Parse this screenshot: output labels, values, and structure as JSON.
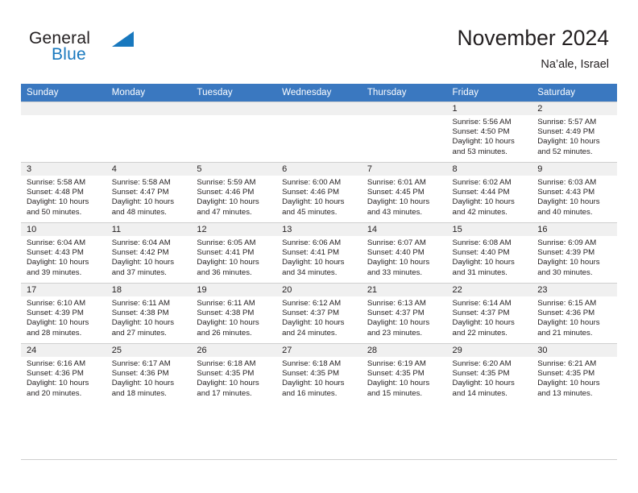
{
  "brand": {
    "word_one": "General",
    "word_two": "Blue",
    "triangle_icon": "triangle-logo-icon"
  },
  "header": {
    "title": "November 2024",
    "subtitle": "Na’ale, Israel"
  },
  "colors": {
    "header_blue": "#3a78c0",
    "brand_blue": "#1878be",
    "daynum_strip": "#f0f0f0",
    "grid_line": "#cfcfcf",
    "text": "#231f20"
  },
  "calendar": {
    "weekday_headers": [
      "Sunday",
      "Monday",
      "Tuesday",
      "Wednesday",
      "Thursday",
      "Friday",
      "Saturday"
    ],
    "weeks": [
      [
        {
          "day": "",
          "empty": true,
          "lines": []
        },
        {
          "day": "",
          "empty": true,
          "lines": []
        },
        {
          "day": "",
          "empty": true,
          "lines": []
        },
        {
          "day": "",
          "empty": true,
          "lines": []
        },
        {
          "day": "",
          "empty": true,
          "lines": []
        },
        {
          "day": "1",
          "empty": false,
          "lines": [
            "Sunrise: 5:56 AM",
            "Sunset: 4:50 PM",
            "Daylight: 10 hours",
            "and 53 minutes."
          ]
        },
        {
          "day": "2",
          "empty": false,
          "lines": [
            "Sunrise: 5:57 AM",
            "Sunset: 4:49 PM",
            "Daylight: 10 hours",
            "and 52 minutes."
          ]
        }
      ],
      [
        {
          "day": "3",
          "empty": false,
          "lines": [
            "Sunrise: 5:58 AM",
            "Sunset: 4:48 PM",
            "Daylight: 10 hours",
            "and 50 minutes."
          ]
        },
        {
          "day": "4",
          "empty": false,
          "lines": [
            "Sunrise: 5:58 AM",
            "Sunset: 4:47 PM",
            "Daylight: 10 hours",
            "and 48 minutes."
          ]
        },
        {
          "day": "5",
          "empty": false,
          "lines": [
            "Sunrise: 5:59 AM",
            "Sunset: 4:46 PM",
            "Daylight: 10 hours",
            "and 47 minutes."
          ]
        },
        {
          "day": "6",
          "empty": false,
          "lines": [
            "Sunrise: 6:00 AM",
            "Sunset: 4:46 PM",
            "Daylight: 10 hours",
            "and 45 minutes."
          ]
        },
        {
          "day": "7",
          "empty": false,
          "lines": [
            "Sunrise: 6:01 AM",
            "Sunset: 4:45 PM",
            "Daylight: 10 hours",
            "and 43 minutes."
          ]
        },
        {
          "day": "8",
          "empty": false,
          "lines": [
            "Sunrise: 6:02 AM",
            "Sunset: 4:44 PM",
            "Daylight: 10 hours",
            "and 42 minutes."
          ]
        },
        {
          "day": "9",
          "empty": false,
          "lines": [
            "Sunrise: 6:03 AM",
            "Sunset: 4:43 PM",
            "Daylight: 10 hours",
            "and 40 minutes."
          ]
        }
      ],
      [
        {
          "day": "10",
          "empty": false,
          "lines": [
            "Sunrise: 6:04 AM",
            "Sunset: 4:43 PM",
            "Daylight: 10 hours",
            "and 39 minutes."
          ]
        },
        {
          "day": "11",
          "empty": false,
          "lines": [
            "Sunrise: 6:04 AM",
            "Sunset: 4:42 PM",
            "Daylight: 10 hours",
            "and 37 minutes."
          ]
        },
        {
          "day": "12",
          "empty": false,
          "lines": [
            "Sunrise: 6:05 AM",
            "Sunset: 4:41 PM",
            "Daylight: 10 hours",
            "and 36 minutes."
          ]
        },
        {
          "day": "13",
          "empty": false,
          "lines": [
            "Sunrise: 6:06 AM",
            "Sunset: 4:41 PM",
            "Daylight: 10 hours",
            "and 34 minutes."
          ]
        },
        {
          "day": "14",
          "empty": false,
          "lines": [
            "Sunrise: 6:07 AM",
            "Sunset: 4:40 PM",
            "Daylight: 10 hours",
            "and 33 minutes."
          ]
        },
        {
          "day": "15",
          "empty": false,
          "lines": [
            "Sunrise: 6:08 AM",
            "Sunset: 4:40 PM",
            "Daylight: 10 hours",
            "and 31 minutes."
          ]
        },
        {
          "day": "16",
          "empty": false,
          "lines": [
            "Sunrise: 6:09 AM",
            "Sunset: 4:39 PM",
            "Daylight: 10 hours",
            "and 30 minutes."
          ]
        }
      ],
      [
        {
          "day": "17",
          "empty": false,
          "lines": [
            "Sunrise: 6:10 AM",
            "Sunset: 4:39 PM",
            "Daylight: 10 hours",
            "and 28 minutes."
          ]
        },
        {
          "day": "18",
          "empty": false,
          "lines": [
            "Sunrise: 6:11 AM",
            "Sunset: 4:38 PM",
            "Daylight: 10 hours",
            "and 27 minutes."
          ]
        },
        {
          "day": "19",
          "empty": false,
          "lines": [
            "Sunrise: 6:11 AM",
            "Sunset: 4:38 PM",
            "Daylight: 10 hours",
            "and 26 minutes."
          ]
        },
        {
          "day": "20",
          "empty": false,
          "lines": [
            "Sunrise: 6:12 AM",
            "Sunset: 4:37 PM",
            "Daylight: 10 hours",
            "and 24 minutes."
          ]
        },
        {
          "day": "21",
          "empty": false,
          "lines": [
            "Sunrise: 6:13 AM",
            "Sunset: 4:37 PM",
            "Daylight: 10 hours",
            "and 23 minutes."
          ]
        },
        {
          "day": "22",
          "empty": false,
          "lines": [
            "Sunrise: 6:14 AM",
            "Sunset: 4:37 PM",
            "Daylight: 10 hours",
            "and 22 minutes."
          ]
        },
        {
          "day": "23",
          "empty": false,
          "lines": [
            "Sunrise: 6:15 AM",
            "Sunset: 4:36 PM",
            "Daylight: 10 hours",
            "and 21 minutes."
          ]
        }
      ],
      [
        {
          "day": "24",
          "empty": false,
          "lines": [
            "Sunrise: 6:16 AM",
            "Sunset: 4:36 PM",
            "Daylight: 10 hours",
            "and 20 minutes."
          ]
        },
        {
          "day": "25",
          "empty": false,
          "lines": [
            "Sunrise: 6:17 AM",
            "Sunset: 4:36 PM",
            "Daylight: 10 hours",
            "and 18 minutes."
          ]
        },
        {
          "day": "26",
          "empty": false,
          "lines": [
            "Sunrise: 6:18 AM",
            "Sunset: 4:35 PM",
            "Daylight: 10 hours",
            "and 17 minutes."
          ]
        },
        {
          "day": "27",
          "empty": false,
          "lines": [
            "Sunrise: 6:18 AM",
            "Sunset: 4:35 PM",
            "Daylight: 10 hours",
            "and 16 minutes."
          ]
        },
        {
          "day": "28",
          "empty": false,
          "lines": [
            "Sunrise: 6:19 AM",
            "Sunset: 4:35 PM",
            "Daylight: 10 hours",
            "and 15 minutes."
          ]
        },
        {
          "day": "29",
          "empty": false,
          "lines": [
            "Sunrise: 6:20 AM",
            "Sunset: 4:35 PM",
            "Daylight: 10 hours",
            "and 14 minutes."
          ]
        },
        {
          "day": "30",
          "empty": false,
          "lines": [
            "Sunrise: 6:21 AM",
            "Sunset: 4:35 PM",
            "Daylight: 10 hours",
            "and 13 minutes."
          ]
        }
      ]
    ]
  }
}
